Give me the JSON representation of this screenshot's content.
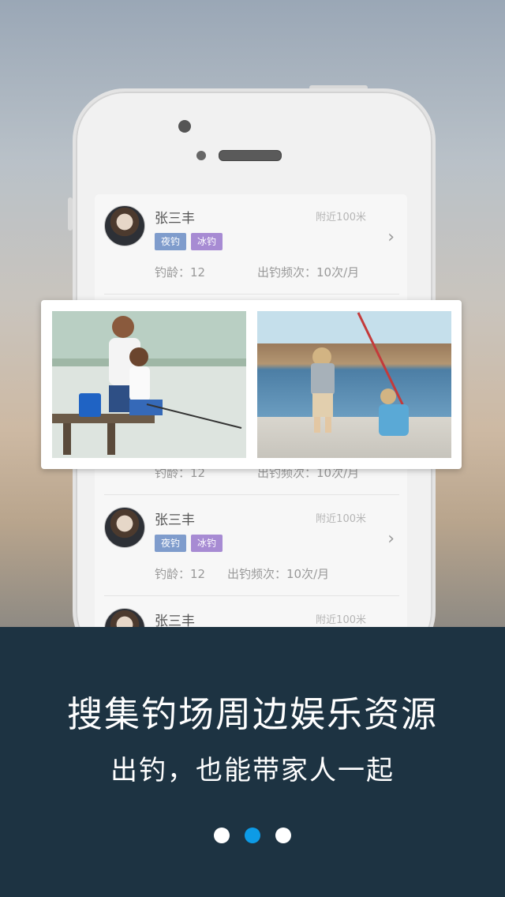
{
  "listing": {
    "items": [
      {
        "name": "张三丰",
        "distance": "附近100米",
        "tags": [
          "夜钓",
          "冰钓"
        ],
        "age_label": "钓龄：12",
        "freq_label": "出钓频次：10次/月"
      },
      {
        "name": "",
        "distance": "",
        "tags": [],
        "age_label": "钓龄：12",
        "freq_label": "出钓频次：10次/月"
      },
      {
        "name": "张三丰",
        "distance": "附近100米",
        "tags": [
          "夜钓",
          "冰钓"
        ],
        "age_label": "钓龄：12",
        "freq_label": "出钓频次：10次/月"
      },
      {
        "name": "张三丰",
        "distance": "附近100米",
        "tags": [],
        "age_label": "",
        "freq_label": ""
      }
    ]
  },
  "banner": {
    "headline": "搜集钓场周边娱乐资源",
    "subline": "出钓，也能带家人一起"
  },
  "pagination": {
    "total": 3,
    "active_index": 1
  },
  "colors": {
    "panel": "#1d3342",
    "active_dot": "#0d9be6",
    "tag_night": "#7f9ccc",
    "tag_ice": "#a78bd3"
  }
}
